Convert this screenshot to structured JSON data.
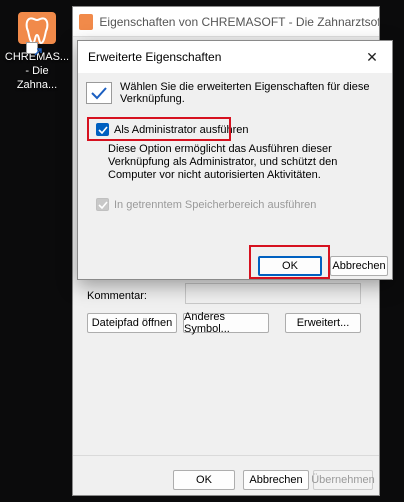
{
  "desktop": {
    "shortcut_label_line1": "CHREMAS...",
    "shortcut_label_line2": "- Die Zahna..."
  },
  "background_window": {
    "title": "Eigenschaften von CHREMASOFT - Die Zahnarztsoftware",
    "comment_label": "Kommentar:",
    "buttons": {
      "open_path": "Dateipfad öffnen",
      "change_icon": "Anderes Symbol...",
      "advanced": "Erweitert..."
    },
    "footer": {
      "ok": "OK",
      "cancel": "Abbrechen",
      "apply": "Übernehmen"
    }
  },
  "dialog": {
    "title": "Erweiterte Eigenschaften",
    "close_glyph": "✕",
    "info_text": "Wählen Sie die erweiterten Eigenschaften für diese Verknüpfung.",
    "run_as_admin": {
      "label": "Als Administrator ausführen",
      "checked": true
    },
    "description": "Diese Option ermöglicht das Ausführen dieser Verknüpfung als Administrator, und schützt den Computer vor nicht autorisierten Aktivitäten.",
    "separate_memory": {
      "label": "In getrenntem Speicherbereich ausführen",
      "checked": true,
      "disabled": true
    },
    "ok": "OK",
    "cancel": "Abbrechen"
  },
  "colors": {
    "accent": "#0060c0",
    "highlight": "#d6111f",
    "app_orange": "#f18a4a"
  }
}
